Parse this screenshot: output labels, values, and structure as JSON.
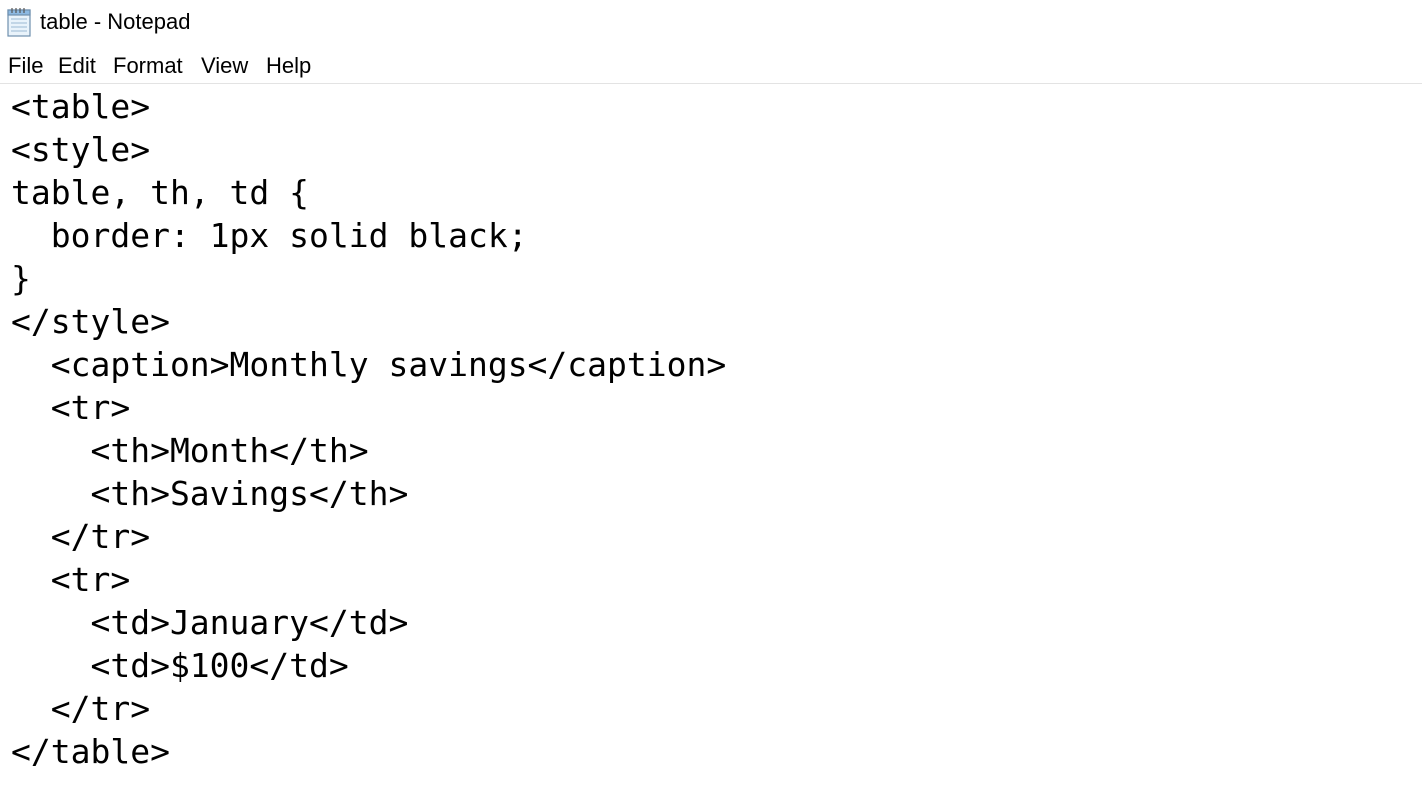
{
  "window": {
    "title": "table - Notepad",
    "icon": "notepad-icon"
  },
  "menu": {
    "file": "File",
    "edit": "Edit",
    "format": "Format",
    "view": "View",
    "help": "Help"
  },
  "editor": {
    "lines": [
      "<table>",
      "<style>",
      "table, th, td {",
      "  border: 1px solid black;",
      "}",
      "</style>",
      "  <caption>Monthly savings</caption>",
      "  <tr>",
      "    <th>Month</th>",
      "    <th>Savings</th>",
      "  </tr>",
      "  <tr>",
      "    <td>January</td>",
      "    <td>$100</td>",
      "  </tr>",
      "</table>"
    ]
  }
}
